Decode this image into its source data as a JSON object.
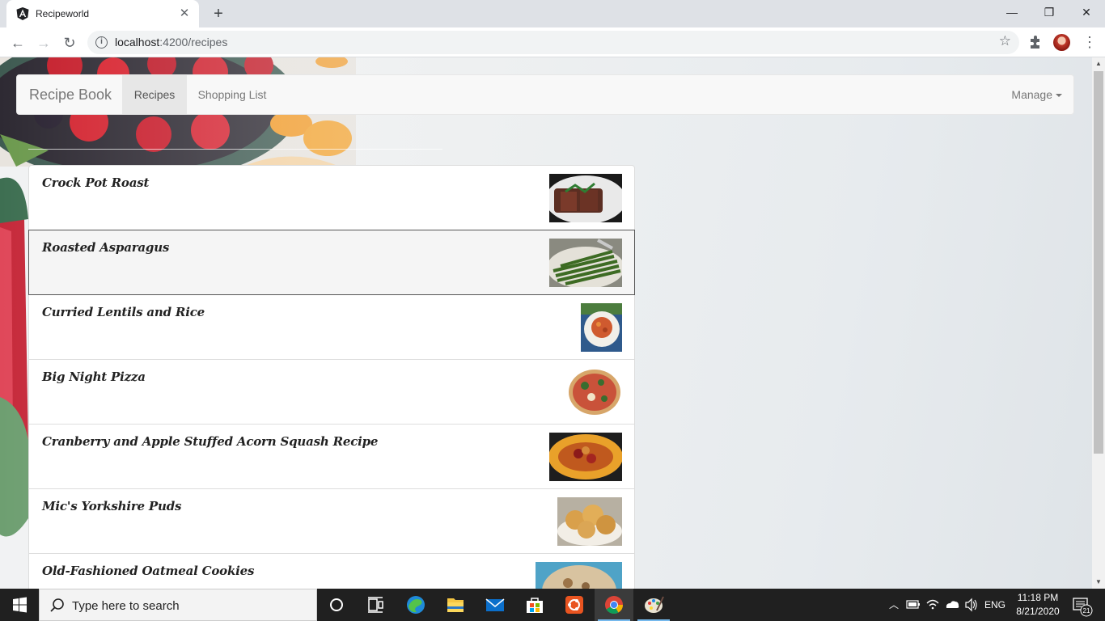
{
  "browser": {
    "tab_title": "Recipeworld",
    "url_host": "localhost",
    "url_rest": ":4200/recipes"
  },
  "navbar": {
    "brand": "Recipe Book",
    "links": [
      "Recipes",
      "Shopping List"
    ],
    "active": "Recipes",
    "manage": "Manage"
  },
  "recipes": [
    {
      "name": "Crock Pot Roast",
      "image": "roast beef with greens on plate"
    },
    {
      "name": "Roasted Asparagus",
      "image": "roasted asparagus"
    },
    {
      "name": "Curried Lentils and Rice",
      "image": "curried lentils and rice"
    },
    {
      "name": "Big Night Pizza",
      "image": "pizza"
    },
    {
      "name": "Cranberry and Apple Stuffed Acorn Squash Recipe",
      "image": "stuffed acorn squash"
    },
    {
      "name": "Mic's Yorkshire Puds",
      "image": "yorkshire puddings"
    },
    {
      "name": "Old-Fashioned Oatmeal Cookies",
      "image": "oatmeal cookies"
    }
  ],
  "taskbar": {
    "search_placeholder": "Type here to search",
    "lang": "ENG",
    "time": "11:18 PM",
    "date": "8/21/2020",
    "notifications": "21"
  }
}
